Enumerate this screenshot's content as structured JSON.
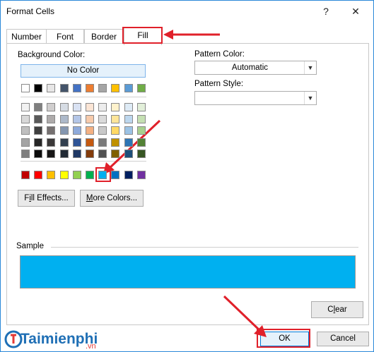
{
  "window": {
    "title": "Format Cells",
    "help": "?",
    "close": "✕"
  },
  "tabs": [
    {
      "label": "Number"
    },
    {
      "label": "Font"
    },
    {
      "label": "Border"
    },
    {
      "label": "Fill"
    }
  ],
  "fill": {
    "background_color_label": "Background Color:",
    "no_color_label": "No Color",
    "pattern_color_label": "Pattern Color:",
    "pattern_color_value": "Automatic",
    "pattern_style_label": "Pattern Style:",
    "pattern_style_value": "",
    "fill_effects_label": "Fill Effects...",
    "more_colors_label": "More Colors...",
    "sample_label": "Sample",
    "sample_color": "#00b0f0",
    "selected_color": "#00b0f0",
    "clear_label": "Clear"
  },
  "theme_top": [
    "#ffffff",
    "#000000",
    "#e7e6e6",
    "#44546a",
    "#4472c4",
    "#ed7d31",
    "#a5a5a5",
    "#ffc000",
    "#5b9bd5",
    "#70ad47"
  ],
  "theme_shades": [
    [
      "#f2f2f2",
      "#7f7f7f",
      "#d0cece",
      "#d6dce4",
      "#d9e2f3",
      "#fbe5d5",
      "#ededed",
      "#fff2cc",
      "#deebf6",
      "#e2efd9"
    ],
    [
      "#d8d8d8",
      "#595959",
      "#aeabab",
      "#adb9ca",
      "#b4c6e7",
      "#f7cbac",
      "#dbdbdb",
      "#fee599",
      "#bdd7ee",
      "#c5e0b3"
    ],
    [
      "#bfbfbf",
      "#3f3f3f",
      "#757070",
      "#8496b0",
      "#8eaadb",
      "#f4b183",
      "#c9c9c9",
      "#ffd965",
      "#9cc3e5",
      "#a8d08d"
    ],
    [
      "#a5a5a5",
      "#262626",
      "#3a3838",
      "#323f4f",
      "#2f5496",
      "#c55a11",
      "#7b7b7b",
      "#bf9000",
      "#2e75b5",
      "#538135"
    ],
    [
      "#7f7f7f",
      "#0c0c0c",
      "#171616",
      "#222a35",
      "#1f3864",
      "#833c0b",
      "#525252",
      "#7f6000",
      "#1e4e79",
      "#375623"
    ]
  ],
  "standard_colors": [
    "#c00000",
    "#ff0000",
    "#ffc000",
    "#ffff00",
    "#92d050",
    "#00b050",
    "#00b0f0",
    "#0070c0",
    "#002060",
    "#7030a0"
  ],
  "footer": {
    "ok_label": "OK",
    "cancel_label": "Cancel"
  },
  "watermark": {
    "brand": "Taimienphi",
    "suffix": ".vn"
  },
  "colors": {
    "highlight": "#e0202a",
    "accent": "#2b88d8"
  }
}
